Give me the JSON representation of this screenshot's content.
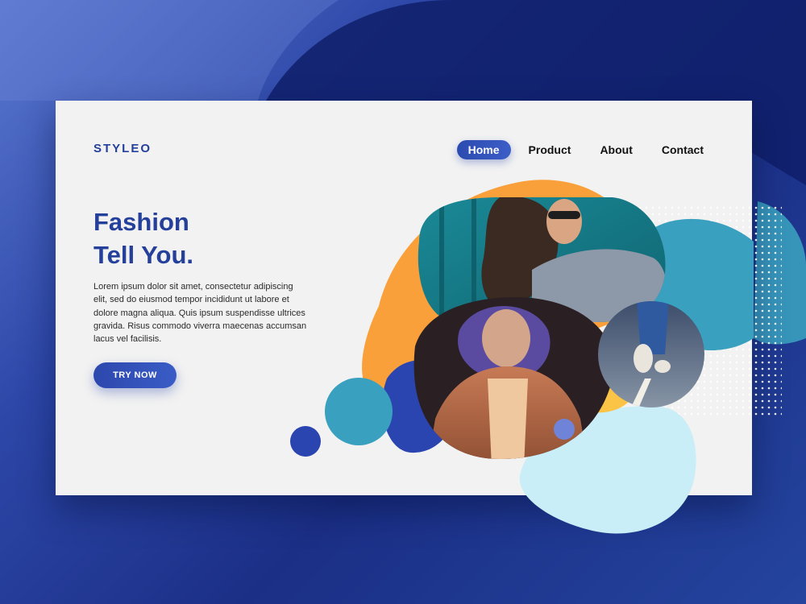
{
  "brand": {
    "logo": "STYLEO"
  },
  "nav": {
    "items": [
      {
        "label": "Home",
        "active": true
      },
      {
        "label": "Product",
        "active": false
      },
      {
        "label": "About",
        "active": false
      },
      {
        "label": "Contact",
        "active": false
      }
    ]
  },
  "hero": {
    "title_line1": "Fashion",
    "title_line2": "Tell You.",
    "body": "Lorem ipsum dolor sit amet, consectetur adipiscing elit, sed do eiusmod tempor incididunt ut labore et dolore magna aliqua. Quis ipsum suspendisse ultrices gravida. Risus commodo viverra maecenas accumsan lacus vel facilisis.",
    "cta_label": "TRY NOW"
  },
  "colors": {
    "primary": "#25409a",
    "orange": "#f9a03a",
    "yellow": "#fbc447",
    "teal": "#3aa0bf",
    "light_blue": "#c9eef7",
    "card_bg": "#f2f2f2"
  }
}
